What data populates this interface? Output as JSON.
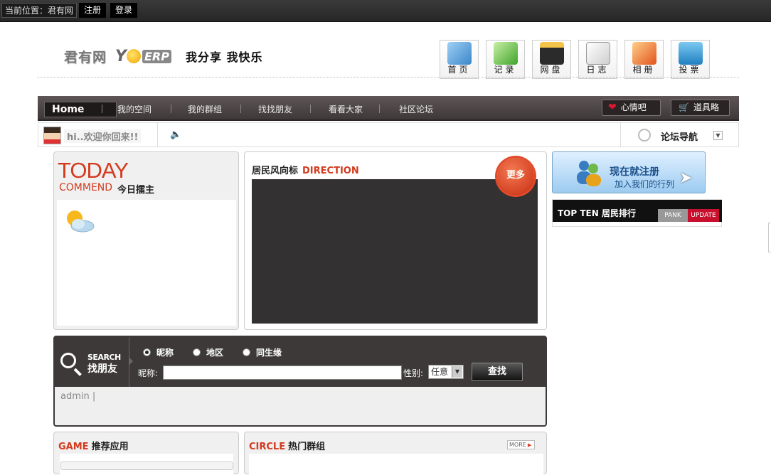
{
  "topbar": {
    "crumb": "当前位置：君有网",
    "register": "注册",
    "login": "登录"
  },
  "logo": {
    "cn": "君有网",
    "yo": "YO",
    "erp": "ERP",
    "slogan": "我分享 我快乐"
  },
  "quick_icons": [
    {
      "label": "首页",
      "icon": "folder-icon"
    },
    {
      "label": "记录",
      "icon": "checklist-icon"
    },
    {
      "label": "网盘",
      "icon": "drive-icon"
    },
    {
      "label": "日志",
      "icon": "notebook-icon"
    },
    {
      "label": "相册",
      "icon": "photo-album-icon"
    },
    {
      "label": "投票",
      "icon": "chart-icon"
    }
  ],
  "nav": {
    "home": "Home",
    "items": [
      "我的空间",
      "我的群组",
      "找找朋友",
      "看看大家",
      "社区论坛"
    ],
    "mood": "心情吧",
    "props": "道具略"
  },
  "welcome": {
    "greeting": "hi..欢迎你回来!!",
    "forum_nav": "论坛导航"
  },
  "today": {
    "big": "TODAY",
    "commend": "COMMEND",
    "zh": "今日擂主"
  },
  "direction": {
    "title_zh": "居民风向标",
    "title_en": "DIRECTION",
    "more": "更多"
  },
  "register_banner": {
    "line1": "现在就注册",
    "line2": "加入我们的行列"
  },
  "topten": {
    "title": "TOP TEN 居民排行",
    "rank": "PANK",
    "update": "UPDATE"
  },
  "search": {
    "en": "SEARCH",
    "zh": "找朋友",
    "radios": [
      "昵称",
      "地区",
      "同生缘"
    ],
    "selected_radio": "昵称",
    "nick_label": "昵称:",
    "gender_label": "性别:",
    "gender_value": "任意",
    "button": "查找",
    "tags": "admin |"
  },
  "game": {
    "title_en": "GAME",
    "title_zh": "推荐应用"
  },
  "circle": {
    "title_en": "CIRCLE",
    "title_zh": "热门群组",
    "more": "MORE"
  },
  "colors": {
    "accent_red": "#d33b1f",
    "nav_bg": "#4a4343",
    "panel_bg": "#f0f0f0",
    "register_blue": "#9ccbf0"
  }
}
